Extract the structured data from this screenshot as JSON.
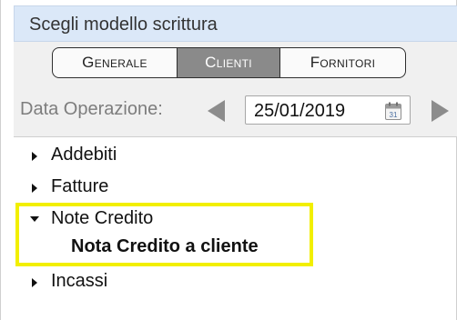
{
  "panel": {
    "title": "Scegli modello scrittura"
  },
  "tabs": [
    {
      "label": "Generale",
      "selected": false
    },
    {
      "label": "Clienti",
      "selected": true
    },
    {
      "label": "Fornitori",
      "selected": false
    }
  ],
  "date_bar": {
    "label": "Data Operazione:",
    "date_value": "25/01/2019",
    "calendar_icon_day": "31"
  },
  "tree": [
    {
      "label": "Addebiti",
      "expanded": false
    },
    {
      "label": "Fatture",
      "expanded": false
    },
    {
      "label": "Note Credito",
      "expanded": true,
      "children": [
        {
          "label": "Nota Credito a cliente"
        }
      ]
    },
    {
      "label": "Incassi",
      "expanded": false
    }
  ],
  "colors": {
    "header_bg": "#dbe8f8",
    "selected_tab_bg": "#8a8a8a",
    "highlight_border": "#f2ef00"
  }
}
